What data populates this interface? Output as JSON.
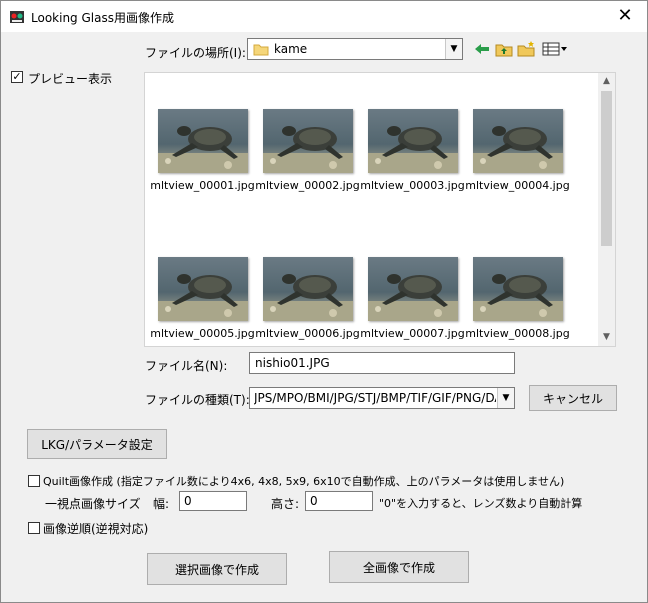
{
  "window": {
    "title": "Looking Glass用画像作成"
  },
  "location": {
    "label": "ファイルの場所(I):",
    "folder": "kame"
  },
  "preview": {
    "label": "プレビュー表示",
    "checked": true
  },
  "files": [
    {
      "name": "mltview_00001.jpg"
    },
    {
      "name": "mltview_00002.jpg"
    },
    {
      "name": "mltview_00003.jpg"
    },
    {
      "name": "mltview_00004.jpg"
    },
    {
      "name": "mltview_00005.jpg"
    },
    {
      "name": "mltview_00006.jpg"
    },
    {
      "name": "mltview_00007.jpg"
    },
    {
      "name": "mltview_00008.jpg"
    }
  ],
  "filename": {
    "label": "ファイル名(N):",
    "value": "nishio01.JPG"
  },
  "filetype": {
    "label": "ファイルの種類(T):",
    "value": "JPS/MPO/BMI/JPG/STJ/BMP/TIF/GIF/PNG/DAS"
  },
  "cancel_label": "キャンセル",
  "lkg_label": "LKG/パラメータ設定",
  "quilt": {
    "label": "Quilt画像作成 (指定ファイル数により4x6, 4x8, 5x9, 6x10で自動作成、上のパラメータは使用しません)",
    "checked": false
  },
  "viewpoint": {
    "label": "一視点画像サイズ",
    "width_label": "幅:",
    "width_value": "0",
    "height_label": "高さ:",
    "height_value": "0",
    "hint": "\"0\"を入力すると、レンズ数より自動計算"
  },
  "reverse": {
    "label": "画像逆順(逆視対応)",
    "checked": false
  },
  "create_selected_label": "選択画像で作成",
  "create_all_label": "全画像で作成"
}
